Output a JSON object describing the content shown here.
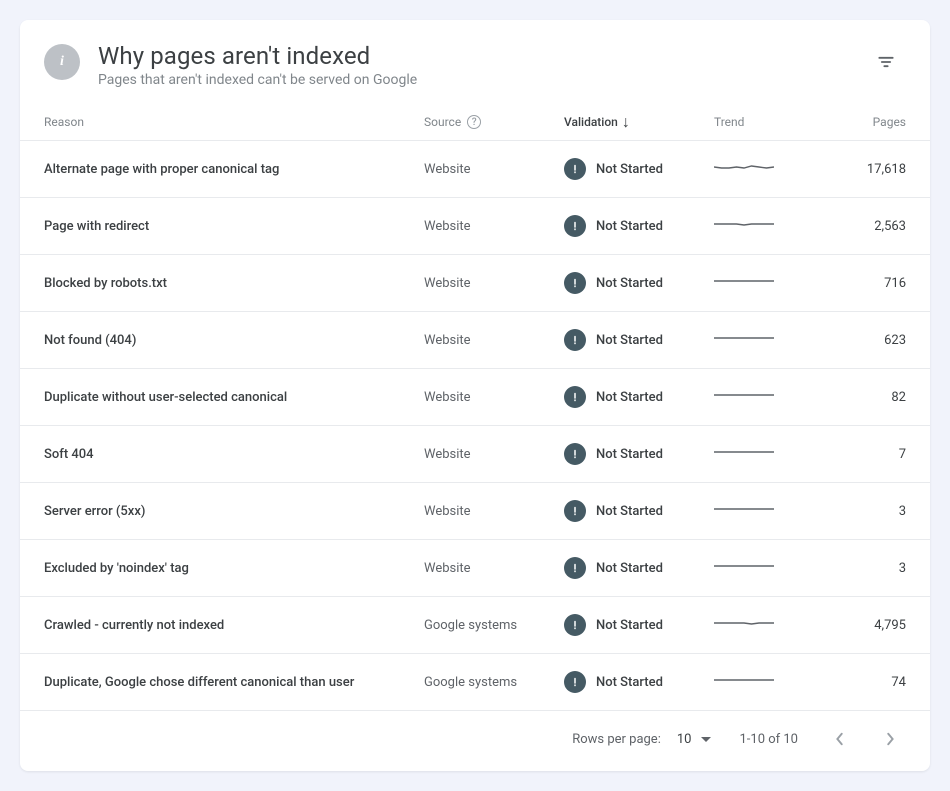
{
  "header": {
    "title": "Why pages aren't indexed",
    "subtitle": "Pages that aren't indexed can't be served on Google"
  },
  "columns": {
    "reason": "Reason",
    "source": "Source",
    "validation": "Validation",
    "trend": "Trend",
    "pages": "Pages"
  },
  "validation_status_label": "Not Started",
  "rows": [
    {
      "reason": "Alternate page with proper canonical tag",
      "source": "Website",
      "validation": "Not Started",
      "pages": "17,618",
      "trend": [
        10,
        9,
        9,
        10,
        9,
        11,
        10,
        9,
        10
      ]
    },
    {
      "reason": "Page with redirect",
      "source": "Website",
      "validation": "Not Started",
      "pages": "2,563",
      "trend": [
        10,
        10,
        10,
        10,
        9,
        10,
        10,
        10,
        10
      ]
    },
    {
      "reason": "Blocked by robots.txt",
      "source": "Website",
      "validation": "Not Started",
      "pages": "716",
      "trend": [
        10,
        10,
        10,
        10,
        10,
        10,
        10,
        10,
        10
      ]
    },
    {
      "reason": "Not found (404)",
      "source": "Website",
      "validation": "Not Started",
      "pages": "623",
      "trend": [
        10,
        10,
        10,
        10,
        10,
        10,
        10,
        10,
        10
      ]
    },
    {
      "reason": "Duplicate without user-selected canonical",
      "source": "Website",
      "validation": "Not Started",
      "pages": "82",
      "trend": [
        10,
        10,
        10,
        10,
        10,
        10,
        10,
        10,
        10
      ]
    },
    {
      "reason": "Soft 404",
      "source": "Website",
      "validation": "Not Started",
      "pages": "7",
      "trend": [
        10,
        10,
        10,
        10,
        10,
        10,
        10,
        10,
        10
      ]
    },
    {
      "reason": "Server error (5xx)",
      "source": "Website",
      "validation": "Not Started",
      "pages": "3",
      "trend": [
        10,
        10,
        10,
        10,
        10,
        10,
        10,
        10,
        10
      ]
    },
    {
      "reason": "Excluded by 'noindex' tag",
      "source": "Website",
      "validation": "Not Started",
      "pages": "3",
      "trend": [
        10,
        10,
        10,
        10,
        10,
        10,
        10,
        10,
        10
      ]
    },
    {
      "reason": "Crawled - currently not indexed",
      "source": "Google systems",
      "validation": "Not Started",
      "pages": "4,795",
      "trend": [
        10,
        10,
        10,
        10,
        10,
        9,
        10,
        10,
        10
      ]
    },
    {
      "reason": "Duplicate, Google chose different canonical than user",
      "source": "Google systems",
      "validation": "Not Started",
      "pages": "74",
      "trend": [
        10,
        10,
        10,
        10,
        10,
        10,
        10,
        10,
        10
      ]
    }
  ],
  "footer": {
    "rows_per_page_label": "Rows per page:",
    "rows_per_page_value": "10",
    "range": "1-10 of 10"
  }
}
